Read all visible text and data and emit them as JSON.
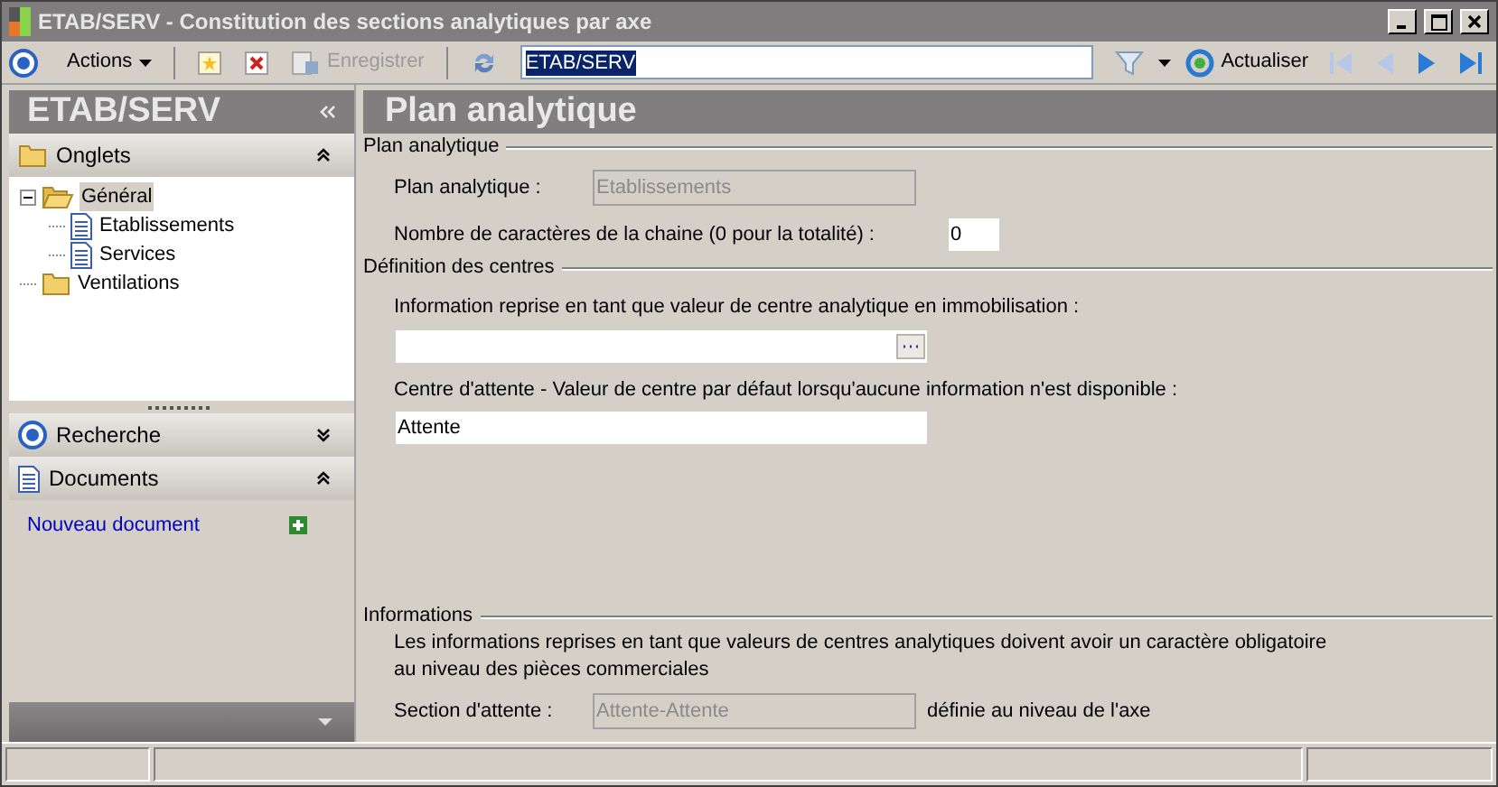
{
  "window": {
    "title": "ETAB/SERV - Constitution des sections analytiques par axe"
  },
  "toolbar": {
    "actions_label": "Actions",
    "save_label": "Enregistrer",
    "save_disabled": true,
    "search_value": "ETAB/SERV",
    "refresh_label": "Actualiser",
    "nav_buttons": [
      {
        "kind": "first",
        "disabled": true
      },
      {
        "kind": "previous",
        "disabled": true
      },
      {
        "kind": "next",
        "disabled": false
      },
      {
        "kind": "last",
        "disabled": false
      }
    ]
  },
  "sidebar": {
    "title": "ETAB/SERV",
    "sections": [
      {
        "kind": "tabs",
        "title": "Onglets",
        "expanded": true,
        "tree": [
          {
            "label": "Général",
            "selected": true,
            "expanded": true,
            "kind": "folder",
            "children": [
              {
                "label": "Etablissements",
                "selected": false,
                "kind": "document"
              },
              {
                "label": "Services",
                "selected": false,
                "kind": "document"
              }
            ]
          },
          {
            "label": "Ventilations",
            "selected": false,
            "kind": "folder"
          }
        ]
      },
      {
        "kind": "search",
        "title": "Recherche",
        "expanded": false
      },
      {
        "kind": "documents",
        "title": "Documents",
        "expanded": true,
        "links": [
          "Nouveau document"
        ]
      }
    ]
  },
  "page": {
    "title": "Plan analytique",
    "groups": [
      {
        "title": "Plan analytique",
        "rows": [
          {
            "kind": "inline",
            "label": "Plan analytique :",
            "value": "Etablissements",
            "disabled": true
          },
          {
            "kind": "inline-short",
            "label": "Nombre de caractères de la chaine (0 pour la totalité) :",
            "value": "0",
            "disabled": false
          }
        ]
      },
      {
        "title": "Définition des centres",
        "rows": [
          {
            "kind": "lookup",
            "label": "Information reprise en tant que valeur de centre analytique en immobilisation :",
            "disabled": false
          },
          {
            "kind": "stacked",
            "label": "Centre d'attente - Valeur de centre par défaut lorsqu'aucune information n'est disponible :",
            "value": "Attente",
            "disabled": false
          }
        ]
      },
      {
        "title": "Informations",
        "rows": [
          {
            "kind": "text",
            "text": "Les informations reprises en tant que valeurs de centres analytiques doivent avoir un caractère obligatoire au niveau des pièces commerciales"
          },
          {
            "kind": "inline",
            "label": "Section d'attente :",
            "value": "Attente-Attente",
            "disabled": true,
            "suffix": "définie au niveau de l'axe"
          }
        ]
      }
    ]
  }
}
